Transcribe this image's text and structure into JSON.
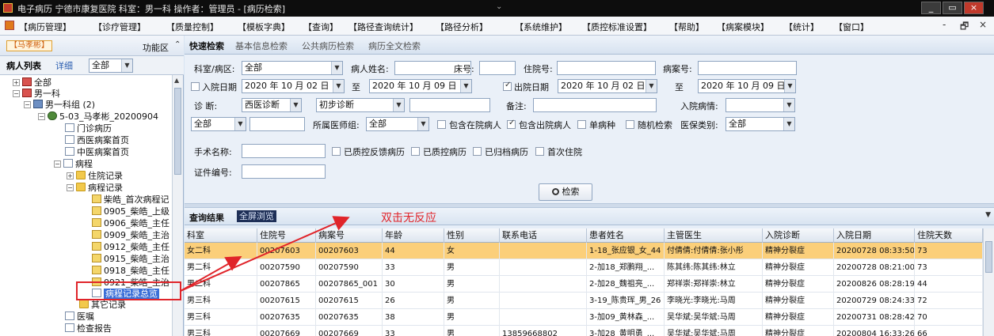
{
  "window": {
    "title": "电子病历  宁德市康复医院  科室：男一科 操作者：管理员 - [病历检索]",
    "controls": [
      "minimize",
      "restore",
      "close"
    ]
  },
  "menu": {
    "items": [
      "【病历管理】",
      "【诊疗管理】",
      "【质量控制】",
      "【模板字典】",
      "【查询】",
      "【路径查询统计】",
      "【路径分析】",
      "【系统维护】",
      "【质控标准设置】",
      "【帮助】",
      "【病案模块】",
      "【统计】",
      "【窗口】"
    ],
    "mdi_controls": [
      "-",
      "🗗",
      "×"
    ]
  },
  "left_panel": {
    "badge": "【马孝彬】",
    "function_area": "功能区",
    "tabs": [
      "病人列表",
      "详细"
    ],
    "filter_value": "全部",
    "tree": [
      {
        "label": "全部",
        "icon": "plusred-icon"
      },
      {
        "label": "男一科",
        "icon": "plusred-icon"
      },
      {
        "label": "男一科组 (2)",
        "icon": "group-icon"
      },
      {
        "label": "5-03_马孝彬_20200904",
        "icon": "person-icon"
      },
      {
        "label": "门诊病历",
        "icon": "doc-icon"
      },
      {
        "label": "西医病案首页",
        "icon": "doc-icon"
      },
      {
        "label": "中医病案首页",
        "icon": "doc-icon"
      },
      {
        "label": "病程",
        "icon": "doc-icon"
      },
      {
        "label": "住院记录",
        "icon": "folder-icon"
      },
      {
        "label": "病程记录",
        "icon": "folder-icon"
      },
      {
        "label": "柴皓_首次病程记",
        "icon": "lock-icon"
      },
      {
        "label": "0905_柴皓_上级",
        "icon": "lock-icon"
      },
      {
        "label": "0906_柴皓_主任",
        "icon": "lock-icon"
      },
      {
        "label": "0909_柴皓_主治",
        "icon": "lock-icon"
      },
      {
        "label": "0912_柴皓_主任",
        "icon": "lock-icon"
      },
      {
        "label": "0915_柴皓_主治",
        "icon": "lock-icon"
      },
      {
        "label": "0918_柴皓_主任",
        "icon": "lock-icon"
      },
      {
        "label": "0921_柴皓_主治",
        "icon": "lock-icon"
      },
      {
        "label": "病程记录总览",
        "icon": "doc-icon"
      },
      {
        "label": "其它记录",
        "icon": "folder-icon"
      },
      {
        "label": "医嘱",
        "icon": "doc-icon"
      },
      {
        "label": "检查报告",
        "icon": "doc-icon"
      }
    ]
  },
  "search_tabs": [
    "快速检索",
    "基本信息检索",
    "公共病历检索",
    "病历全文检索"
  ],
  "form": {
    "dept_label": "科室/病区:",
    "dept_value": "全部",
    "patient_name_label": "病人姓名:",
    "bed_label": "床号:",
    "hosp_no_label": "住院号:",
    "case_no_label": "病案号:",
    "admit_date_label": "入院日期",
    "admit_from": "2020 年 10 月 02 日",
    "to_label_1": "至",
    "admit_to": "2020 年 10 月 09 日",
    "discharge_date_label": "出院日期",
    "discharge_from": "2020 年 10 月 02 日",
    "to_label_2": "至",
    "discharge_to": "2020 年 10 月 09 日",
    "diagnosis_label": "诊    断:",
    "diag_type": "西医诊断",
    "diag_stage": "初步诊断",
    "remark_label": "备注:",
    "admit_condition_label": "入院病情:",
    "scope_value": "全部",
    "doctor_group_label": "所属医师组:",
    "doctor_group_value": "全部",
    "include_inpatient": "包含在院病人",
    "include_discharged": "包含出院病人",
    "single_disease": "单病种",
    "random_check": "随机检索",
    "insurance_label": "医保类别:",
    "insurance_value": "全部",
    "surgery_label": "手术名称:",
    "qc_feedback": "已质控反馈病历",
    "qc_done": "已质控病历",
    "archived": "已归档病历",
    "first_admission": "首次住院",
    "id_label": "证件编号:",
    "search_button": "检索"
  },
  "result_tabs": [
    "查询结果",
    "全屏浏览"
  ],
  "annotation": "双击无反应",
  "table": {
    "columns": [
      "科室",
      "住院号",
      "病案号",
      "年龄",
      "性别",
      "联系电话",
      "患者姓名",
      "主管医生",
      "入院诊断",
      "入院日期",
      "住院天数"
    ],
    "rows": [
      [
        "女二科",
        "00207603",
        "00207603",
        "44",
        "女",
        "",
        "1-18_张应银_女_44",
        "付倩倩:付倩倩:张小彤",
        "精神分裂症",
        "20200728 08:33:50",
        "73"
      ],
      [
        "男二科",
        "00207590",
        "00207590",
        "33",
        "男",
        "",
        "2-加18_郑鹏翔_...",
        "陈其纬:陈其纬:林立",
        "精神分裂症",
        "20200728 08:21:00",
        "73"
      ],
      [
        "男二科",
        "00207865",
        "00207865_001",
        "30",
        "男",
        "",
        "2-加28_魏祖亮_...",
        "郑祥崇:郑祥崇:林立",
        "精神分裂症",
        "20200826 08:28:19",
        "44"
      ],
      [
        "男三科",
        "00207615",
        "00207615",
        "26",
        "男",
        "",
        "3-19_陈贵珲_男_26",
        "李晓光:李晓光:马周",
        "精神分裂症",
        "20200729 08:24:33",
        "72"
      ],
      [
        "男三科",
        "00207635",
        "00207635",
        "38",
        "男",
        "",
        "3-加09_黄林森_...",
        "吴华斌:吴华斌:马周",
        "精神分裂症",
        "20200731 08:28:42",
        "70"
      ],
      [
        "男三科",
        "00207669",
        "00207669",
        "33",
        "男",
        "13859668802",
        "3-加28_黄明勇_...",
        "吴华斌:吴华斌:马周",
        "精神分裂症",
        "20200804 16:33:26",
        "66"
      ]
    ]
  },
  "colors": {
    "selected_row": "#fbcf7a",
    "annotation_red": "#e0242a",
    "tree_selected": "#3a6fd8"
  }
}
